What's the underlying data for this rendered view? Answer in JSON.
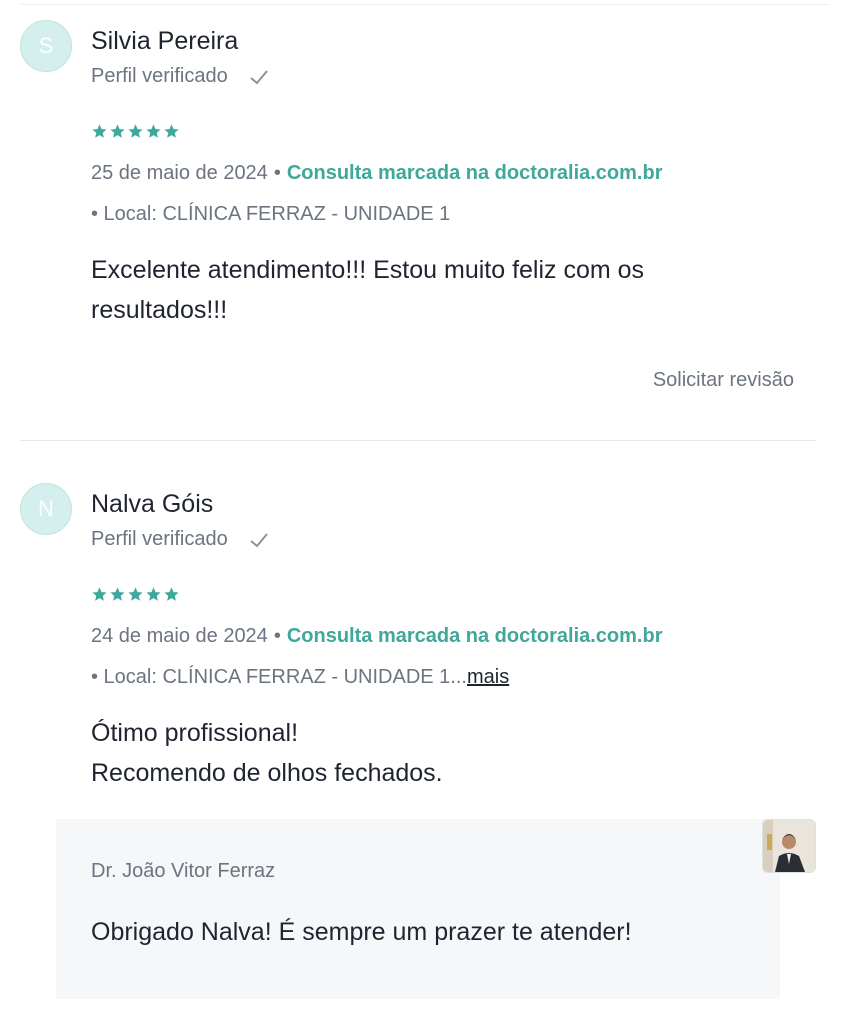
{
  "reviews": [
    {
      "initial": "S",
      "name": "Silvia Pereira",
      "verified": "Perfil verificado",
      "rating": 5,
      "date": "25 de maio de 2024",
      "booked": "Consulta marcada na doctoralia.com.br",
      "location": "• Local: CLÍNICA FERRAZ - UNIDADE 1",
      "text": "Excelente atendimento!!! Estou muito feliz com os resultados!!!",
      "action": "Solicitar revisão"
    },
    {
      "initial": "N",
      "name": "Nalva Góis",
      "verified": "Perfil verificado",
      "rating": 5,
      "date": "24 de maio de 2024",
      "booked": "Consulta marcada na doctoralia.com.br",
      "location": "• Local: CLÍNICA FERRAZ - UNIDADE 1...",
      "more": "mais",
      "text_line1": "Ótimo profissional!",
      "text_line2": "Recomendo de olhos fechados.",
      "reply": {
        "doctor": "Dr. João Vitor Ferraz",
        "text": "Obrigado Nalva! É sempre um prazer te atender!"
      }
    }
  ],
  "colors": {
    "accent": "#3fa89a",
    "muted_text": "#6b7480",
    "avatar_bg": "#d5eeee"
  },
  "icons": {
    "verified": "check-icon",
    "rating": "star-icon"
  },
  "bullet": "•"
}
